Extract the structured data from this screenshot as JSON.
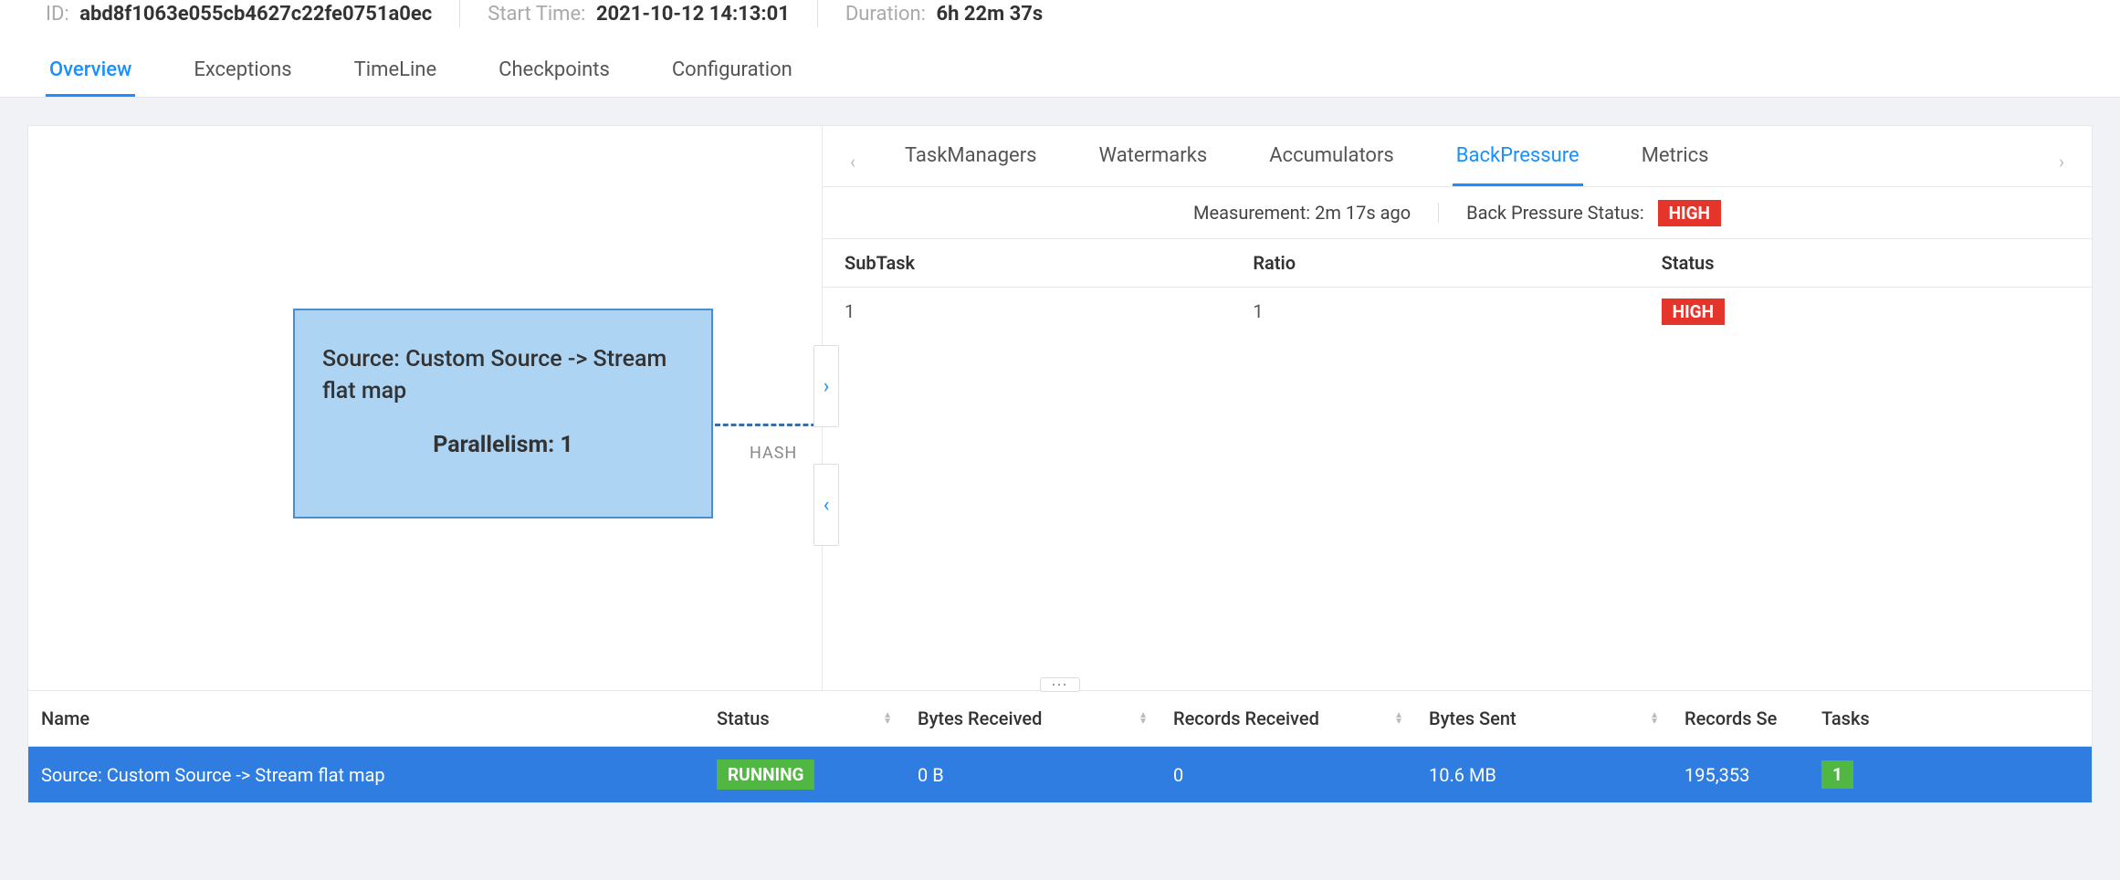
{
  "header": {
    "id_label": "ID:",
    "id_value": "abd8f1063e055cb4627c22fe0751a0ec",
    "start_label": "Start Time:",
    "start_value": "2021-10-12 14:13:01",
    "duration_label": "Duration:",
    "duration_value": "6h 22m 37s"
  },
  "main_tabs": {
    "overview": "Overview",
    "exceptions": "Exceptions",
    "timeline": "TimeLine",
    "checkpoints": "Checkpoints",
    "configuration": "Configuration"
  },
  "graph": {
    "node_title": "Source: Custom Source -> Stream flat map",
    "parallelism_label": "Parallelism: 1",
    "edge_label": "HASH"
  },
  "sub_tabs": {
    "taskmanagers": "TaskManagers",
    "watermarks": "Watermarks",
    "accumulators": "Accumulators",
    "backpressure": "BackPressure",
    "metrics": "Metrics"
  },
  "bp": {
    "measurement_label": "Measurement:",
    "measurement_value": "2m 17s ago",
    "status_label": "Back Pressure Status:",
    "status_badge": "HIGH",
    "cols": {
      "subtask": "SubTask",
      "ratio": "Ratio",
      "status": "Status"
    },
    "row": {
      "subtask": "1",
      "ratio": "1",
      "status": "HIGH"
    }
  },
  "table": {
    "cols": {
      "name": "Name",
      "status": "Status",
      "bytes_received": "Bytes Received",
      "records_received": "Records Received",
      "bytes_sent": "Bytes Sent",
      "records_sent": "Records Se",
      "tasks": "Tasks"
    },
    "row": {
      "name": "Source: Custom Source -> Stream flat map",
      "status": "RUNNING",
      "bytes_received": "0 B",
      "records_received": "0",
      "bytes_sent": "10.6 MB",
      "records_sent": "195,353",
      "tasks": "1"
    }
  }
}
